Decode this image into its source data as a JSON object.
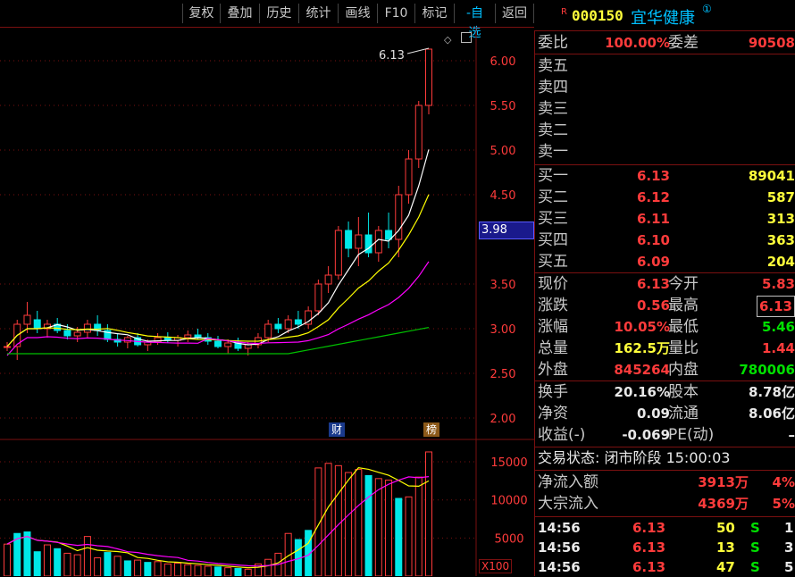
{
  "toolbar": {
    "buttons": [
      "复权",
      "叠加",
      "历史",
      "统计",
      "画线",
      "F10",
      "标记",
      "-自选",
      "返回"
    ]
  },
  "stock": {
    "flag": "R",
    "code": "000150",
    "name": "宜华健康",
    "badge": "①"
  },
  "chart": {
    "price_axis": [
      "6.00",
      "5.50",
      "5.00",
      "4.50",
      "3.50",
      "3.00",
      "2.50",
      "2.00"
    ],
    "current_price_tag": "3.98",
    "high_annotation": "6.13",
    "markers": [
      "财",
      "榜"
    ],
    "volume_axis": [
      "15000",
      "10000",
      "5000"
    ],
    "volume_unit": "X100",
    "colors": {
      "up": "#ff3b3b",
      "down": "#00e8e8",
      "ma5": "#ffffff",
      "ma10": "#ffff00",
      "ma20": "#ff00ff",
      "ma60": "#00c000"
    }
  },
  "chart_data": {
    "type": "candlestick",
    "ylim": [
      1.9,
      6.3
    ],
    "candles": [
      [
        2.8,
        2.85,
        2.75,
        2.8
      ],
      [
        2.8,
        3.1,
        2.65,
        3.05
      ],
      [
        3.05,
        3.3,
        2.95,
        3.15
      ],
      [
        3.1,
        3.2,
        2.95,
        3.0
      ],
      [
        3.0,
        3.1,
        2.9,
        3.05
      ],
      [
        3.05,
        3.12,
        2.95,
        2.98
      ],
      [
        2.98,
        3.05,
        2.88,
        2.92
      ],
      [
        2.92,
        3.02,
        2.85,
        2.96
      ],
      [
        2.96,
        3.1,
        2.9,
        3.05
      ],
      [
        3.05,
        3.15,
        2.92,
        2.98
      ],
      [
        2.98,
        3.05,
        2.85,
        2.88
      ],
      [
        2.88,
        2.95,
        2.8,
        2.85
      ],
      [
        2.85,
        2.92,
        2.78,
        2.9
      ],
      [
        2.9,
        2.95,
        2.8,
        2.82
      ],
      [
        2.82,
        2.88,
        2.75,
        2.85
      ],
      [
        2.85,
        2.95,
        2.82,
        2.9
      ],
      [
        2.9,
        2.96,
        2.84,
        2.87
      ],
      [
        2.87,
        2.93,
        2.8,
        2.9
      ],
      [
        2.9,
        2.98,
        2.85,
        2.93
      ],
      [
        2.93,
        3.0,
        2.88,
        2.9
      ],
      [
        2.9,
        2.95,
        2.82,
        2.86
      ],
      [
        2.86,
        2.92,
        2.78,
        2.8
      ],
      [
        2.8,
        2.88,
        2.72,
        2.84
      ],
      [
        2.84,
        2.9,
        2.75,
        2.78
      ],
      [
        2.78,
        2.85,
        2.7,
        2.82
      ],
      [
        2.82,
        2.95,
        2.78,
        2.9
      ],
      [
        2.9,
        3.1,
        2.85,
        3.05
      ],
      [
        3.05,
        3.12,
        2.95,
        3.0
      ],
      [
        3.0,
        3.15,
        2.95,
        3.1
      ],
      [
        3.1,
        3.2,
        3.0,
        3.05
      ],
      [
        3.05,
        3.25,
        3.0,
        3.2
      ],
      [
        3.2,
        3.55,
        3.15,
        3.5
      ],
      [
        3.5,
        3.7,
        3.4,
        3.6
      ],
      [
        3.6,
        4.15,
        3.55,
        4.1
      ],
      [
        4.1,
        4.2,
        3.8,
        3.9
      ],
      [
        3.9,
        4.25,
        3.7,
        4.05
      ],
      [
        4.05,
        4.3,
        3.8,
        3.85
      ],
      [
        3.85,
        4.15,
        3.75,
        4.1
      ],
      [
        4.1,
        4.3,
        3.9,
        4.0
      ],
      [
        4.0,
        4.6,
        3.8,
        4.5
      ],
      [
        4.5,
        5.0,
        4.4,
        4.9
      ],
      [
        4.9,
        5.55,
        4.8,
        5.5
      ],
      [
        5.5,
        6.13,
        5.4,
        6.13
      ]
    ],
    "volume": [
      4200,
      5600,
      5800,
      3200,
      4100,
      3600,
      3000,
      2800,
      5200,
      2400,
      3100,
      2600,
      2000,
      2100,
      1800,
      1900,
      1600,
      1700,
      1500,
      1400,
      1300,
      1200,
      1100,
      1000,
      900,
      1600,
      2200,
      3000,
      5600,
      4800,
      6000,
      14200,
      14800,
      14500,
      13600,
      14000,
      13200,
      12800,
      12600,
      10200,
      10400,
      13000,
      16300
    ],
    "volume_down_idx": [
      1,
      2,
      3,
      5,
      10,
      12,
      14,
      21,
      23,
      29,
      30,
      36,
      39
    ]
  },
  "panel": {
    "weibi": {
      "label": "委比",
      "value": "100.00%",
      "label2": "委差",
      "value2": "90508"
    },
    "sell": [
      "卖五",
      "卖四",
      "卖三",
      "卖二",
      "卖一"
    ],
    "buy": [
      {
        "label": "买一",
        "price": "6.13",
        "vol": "89041"
      },
      {
        "label": "买二",
        "price": "6.12",
        "vol": "587"
      },
      {
        "label": "买三",
        "price": "6.11",
        "vol": "313"
      },
      {
        "label": "买四",
        "price": "6.10",
        "vol": "363"
      },
      {
        "label": "买五",
        "price": "6.09",
        "vol": "204"
      }
    ],
    "stats1": [
      {
        "l": "现价",
        "v": "6.13",
        "l2": "今开",
        "v2": "5.83"
      },
      {
        "l": "涨跌",
        "v": "0.56",
        "l2": "最高",
        "v2": "6.13"
      },
      {
        "l": "涨幅",
        "v": "10.05%",
        "l2": "最低",
        "v2": "5.46"
      },
      {
        "l": "总量",
        "v": "162.5万",
        "l2": "量比",
        "v2": "1.44"
      },
      {
        "l": "外盘",
        "v": "845264",
        "l2": "内盘",
        "v2": "780006"
      }
    ],
    "stats2": [
      {
        "l": "换手",
        "v": "20.16%",
        "l2": "股本",
        "v2": "8.78亿"
      },
      {
        "l": "净资",
        "v": "0.09",
        "l2": "流通",
        "v2": "8.06亿"
      },
      {
        "l": "收益(-)",
        "v": "-0.069",
        "l2": "PE(动)",
        "v2": "–"
      }
    ],
    "trade_status": "交易状态: 闭市阶段 15:00:03",
    "flow": [
      {
        "l": "净流入额",
        "v": "3913万",
        "p": "4%"
      },
      {
        "l": "大宗流入",
        "v": "4369万",
        "p": "5%"
      }
    ],
    "ticks": [
      {
        "t": "14:56",
        "p": "6.13",
        "v": "50",
        "s": "S",
        "n": "1"
      },
      {
        "t": "14:56",
        "p": "6.13",
        "v": "13",
        "s": "S",
        "n": "3"
      },
      {
        "t": "14:56",
        "p": "6.13",
        "v": "47",
        "s": "S",
        "n": "5"
      }
    ]
  }
}
